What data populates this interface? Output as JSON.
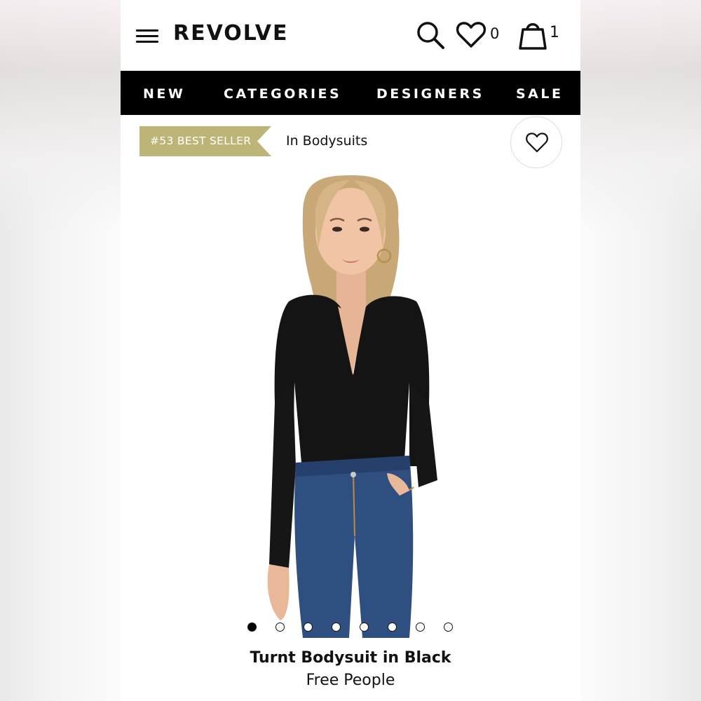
{
  "header": {
    "logo": "REVOLVE",
    "wishlist_count": "0",
    "bag_count": "1"
  },
  "nav": {
    "items": [
      {
        "label": "NEW"
      },
      {
        "label": "CATEGORIES"
      },
      {
        "label": "DESIGNERS"
      },
      {
        "label": "SALE"
      }
    ]
  },
  "badge": {
    "rank_text": "#53 BEST SELLER",
    "category_text": "In Bodysuits",
    "ribbon_color": "#bdb578"
  },
  "carousel": {
    "image_count": 8,
    "active_index": 1
  },
  "product": {
    "title": "Turnt Bodysuit in Black",
    "brand": "Free People"
  },
  "icons": [
    "menu-icon",
    "search-icon",
    "heart-icon",
    "shopping-bag-icon",
    "heart-icon"
  ]
}
